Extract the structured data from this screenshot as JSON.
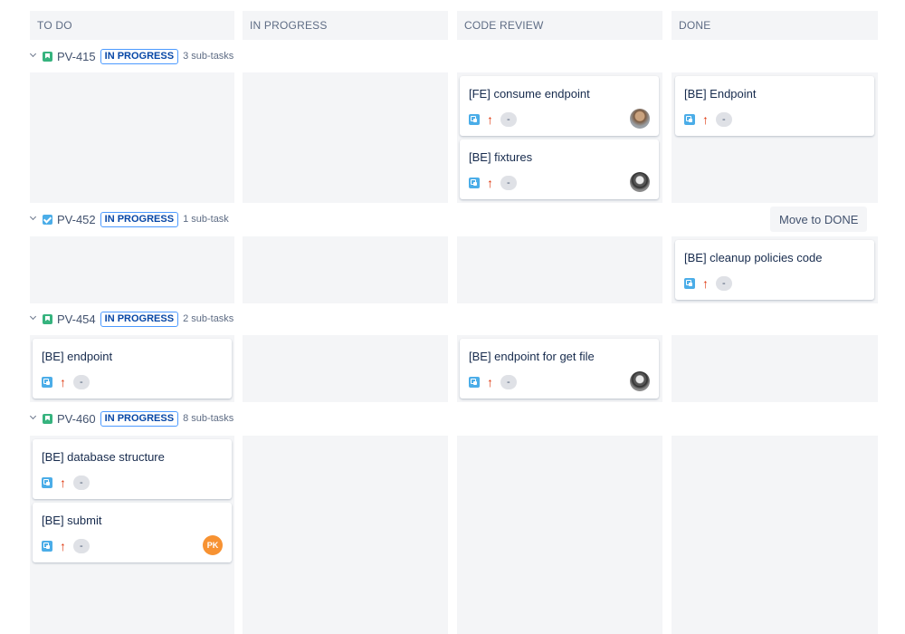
{
  "columns": [
    "TO DO",
    "IN PROGRESS",
    "CODE REVIEW",
    "DONE"
  ],
  "lanes": [
    {
      "key": "PV-415",
      "status": "IN PROGRESS",
      "subtasks": "3 sub-tasks",
      "type_icon": "story-icon"
    },
    {
      "key": "PV-452",
      "status": "IN PROGRESS",
      "subtasks": "1 sub-task",
      "type_icon": "task-icon"
    },
    {
      "key": "PV-454",
      "status": "IN PROGRESS",
      "subtasks": "2 sub-tasks",
      "type_icon": "story-icon"
    },
    {
      "key": "PV-460",
      "status": "IN PROGRESS",
      "subtasks": "8 sub-tasks",
      "type_icon": "story-icon"
    }
  ],
  "cards": {
    "c1": {
      "title": "[FE] consume endpoint",
      "estimate": "-"
    },
    "c2": {
      "title": "[BE] fixtures",
      "estimate": "-"
    },
    "c3": {
      "title": "[BE] Endpoint",
      "estimate": "-"
    },
    "c4": {
      "title": "[BE] cleanup policies code",
      "estimate": "-"
    },
    "c5": {
      "title": "[BE] endpoint",
      "estimate": "-"
    },
    "c6": {
      "title": "[BE] endpoint for get file",
      "estimate": "-"
    },
    "c7": {
      "title": "[BE] database structure",
      "estimate": "-"
    },
    "c8": {
      "title": "[BE] submit",
      "estimate": "-",
      "assignee_initials": "PK"
    }
  },
  "move_button_label": "Move to DONE",
  "icons": {
    "subtask": "subtask-icon",
    "priority": "priority-high-icon",
    "chevron": "chevron-down-icon"
  },
  "colors": {
    "column_bg": "#f4f5f7",
    "story": "#36b37e",
    "task": "#4bade8",
    "priority": "#de350b",
    "initials_avatar": "#f79232"
  }
}
